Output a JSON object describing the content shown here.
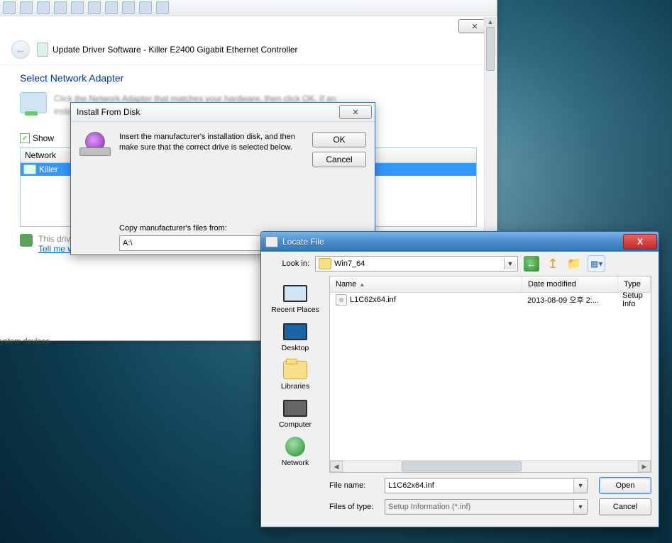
{
  "wizard": {
    "toolbar_icons": [
      "ic",
      "ic",
      "ic",
      "ic",
      "ic",
      "ic",
      "ic",
      "ic",
      "ic",
      "ic"
    ],
    "close_glyph": "✕",
    "back_glyph": "←",
    "title": "Update Driver Software - Killer E2400 Gigabit Ethernet Controller",
    "heading": "Select Network Adapter",
    "desc_line1": "Click the Network Adapter that matches your hardware, then click OK. If an",
    "desc_line2": "installation disk for this feature, click Have Disk",
    "show_compat_label": "Show",
    "list_header": "Network",
    "list_item": "Killer",
    "signed_text": "This driver is digitally signed.",
    "signing_link": "Tell me why driver signing is important",
    "stem": "ystem devices"
  },
  "ifd": {
    "title": "Install From Disk",
    "close_glyph": "✕",
    "msg_line1": "Insert the manufacturer's installation disk, and then",
    "msg_line2": "make sure that the correct drive is selected below.",
    "ok": "OK",
    "cancel": "Cancel",
    "copy_label": "Copy manufacturer's files from:",
    "path_value": "A:\\"
  },
  "locate": {
    "title": "Locate File",
    "close_glyph": "X",
    "lookin_label": "Look in:",
    "lookin_value": "Win7_64",
    "nav": {
      "back": "←",
      "up": "↥",
      "newfolder": "📁",
      "view": "▦▾"
    },
    "places": [
      {
        "label": "Recent Places",
        "type": "recent"
      },
      {
        "label": "Desktop",
        "type": "desktop"
      },
      {
        "label": "Libraries",
        "type": "libraries"
      },
      {
        "label": "Computer",
        "type": "computer"
      },
      {
        "label": "Network",
        "type": "network"
      }
    ],
    "columns": {
      "name": "Name",
      "date": "Date modified",
      "type": "Type"
    },
    "file": {
      "name": "L1C62x64.inf",
      "date": "2013-08-09 오후 2:...",
      "type": "Setup Info"
    },
    "filename_label": "File name:",
    "filename_value": "L1C62x64.inf",
    "filetype_label": "Files of type:",
    "filetype_value": "Setup Information (*.inf)",
    "open": "Open",
    "cancel": "Cancel"
  }
}
